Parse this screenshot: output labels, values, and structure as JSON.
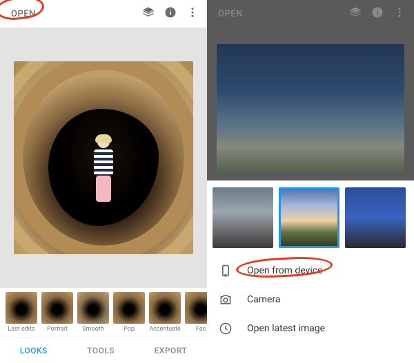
{
  "left": {
    "open_label": "OPEN",
    "looks": [
      {
        "label": "Last edits"
      },
      {
        "label": "Portrait"
      },
      {
        "label": "Smooth"
      },
      {
        "label": "Pop"
      },
      {
        "label": "Accentuate"
      },
      {
        "label": "Fac"
      }
    ],
    "tabs": {
      "looks": "LOOKS",
      "tools": "TOOLS",
      "export": "EXPORT"
    }
  },
  "right": {
    "open_label": "OPEN",
    "options": {
      "open_device": "Open from device",
      "camera": "Camera",
      "open_latest": "Open latest image"
    }
  }
}
